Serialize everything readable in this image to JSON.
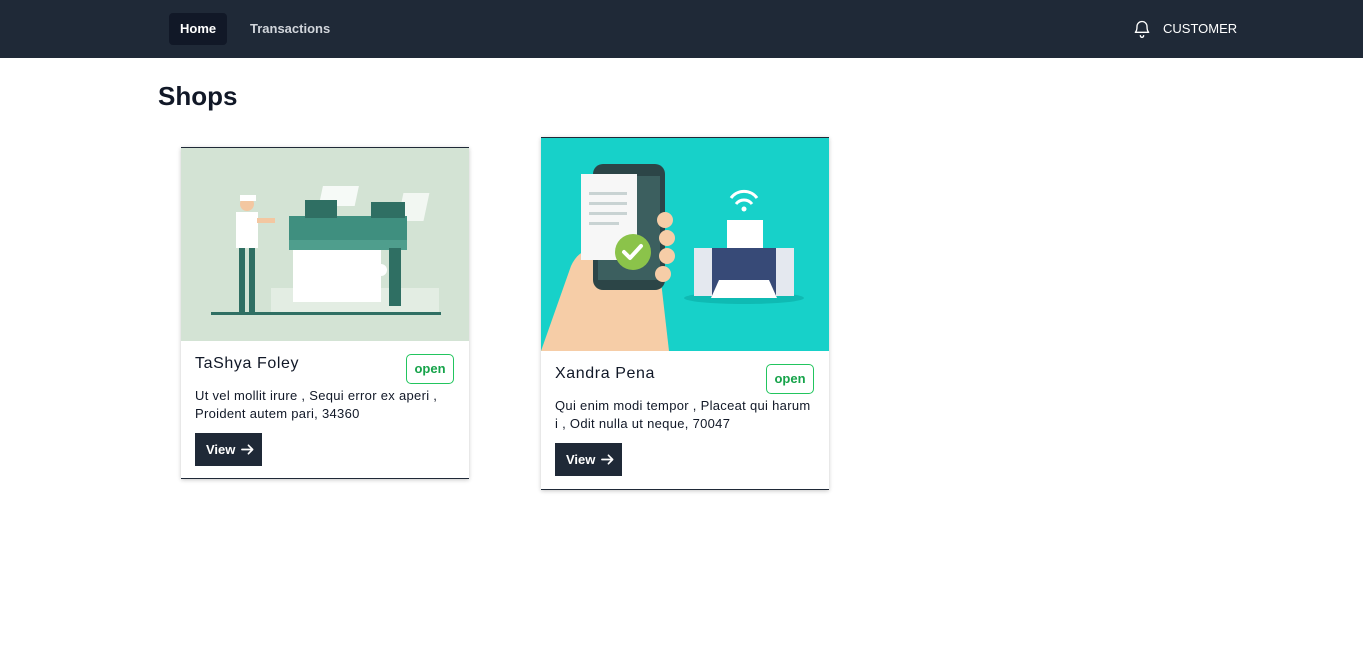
{
  "nav": {
    "links": [
      {
        "label": "Home",
        "active": true
      },
      {
        "label": "Transactions",
        "active": false
      }
    ],
    "notification_icon": "bell-icon",
    "user_role": "CUSTOMER"
  },
  "page_title": "Shops",
  "shops": [
    {
      "name": "TaShya Foley",
      "status": "open",
      "address": "Ut vel mollit irure , Sequi error ex aperi , Proident autem pari, 34360",
      "view_label": "View",
      "image": "printing-machine-illustration"
    },
    {
      "name": "Xandra Pena",
      "status": "open",
      "address": "Qui enim modi tempor , Placeat qui harum i , Odit nulla ut neque, 70047",
      "view_label": "View",
      "image": "mobile-print-illustration"
    }
  ],
  "colors": {
    "navbar": "#1f2937",
    "status_open": "#22c55e",
    "button": "#1f2937"
  }
}
